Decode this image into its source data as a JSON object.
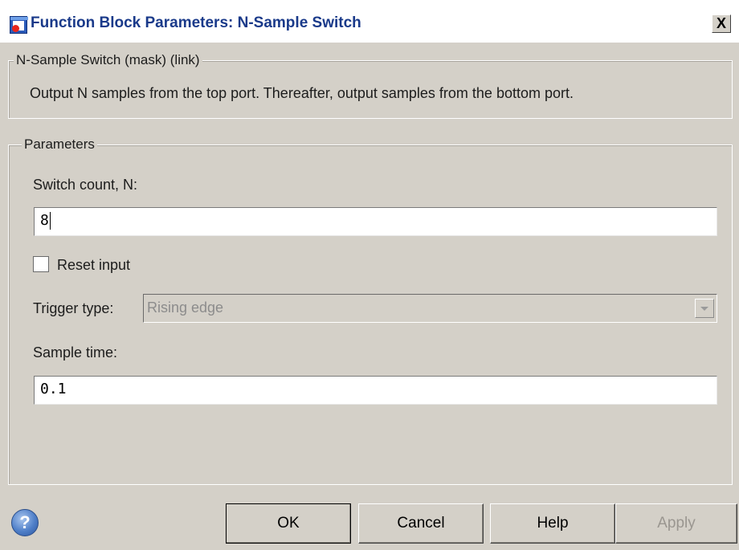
{
  "window": {
    "title": "Function Block Parameters: N-Sample Switch",
    "close_label": "X"
  },
  "description_group": {
    "legend": "N-Sample Switch (mask) (link)",
    "text": "Output N samples from the top port.  Thereafter, output samples from the bottom port."
  },
  "parameters_group": {
    "legend": "Parameters",
    "switch_count": {
      "label": "Switch count, N:",
      "value": "8"
    },
    "reset_input": {
      "label": "Reset input",
      "checked": false
    },
    "trigger_type": {
      "label": "Trigger type:",
      "value": "Rising edge",
      "disabled": true
    },
    "sample_time": {
      "label": "Sample time:",
      "value": "0.1"
    }
  },
  "buttons": {
    "help_icon": "?",
    "ok": "OK",
    "cancel": "Cancel",
    "help": "Help",
    "apply": "Apply"
  },
  "colors": {
    "dialog_background": "#d4d0c8",
    "title_text": "#1a3a8a",
    "disabled_text": "#8c8c8c"
  },
  "icons": {
    "window_icon": "simulink-block-icon",
    "help_icon": "question-circle-icon"
  }
}
